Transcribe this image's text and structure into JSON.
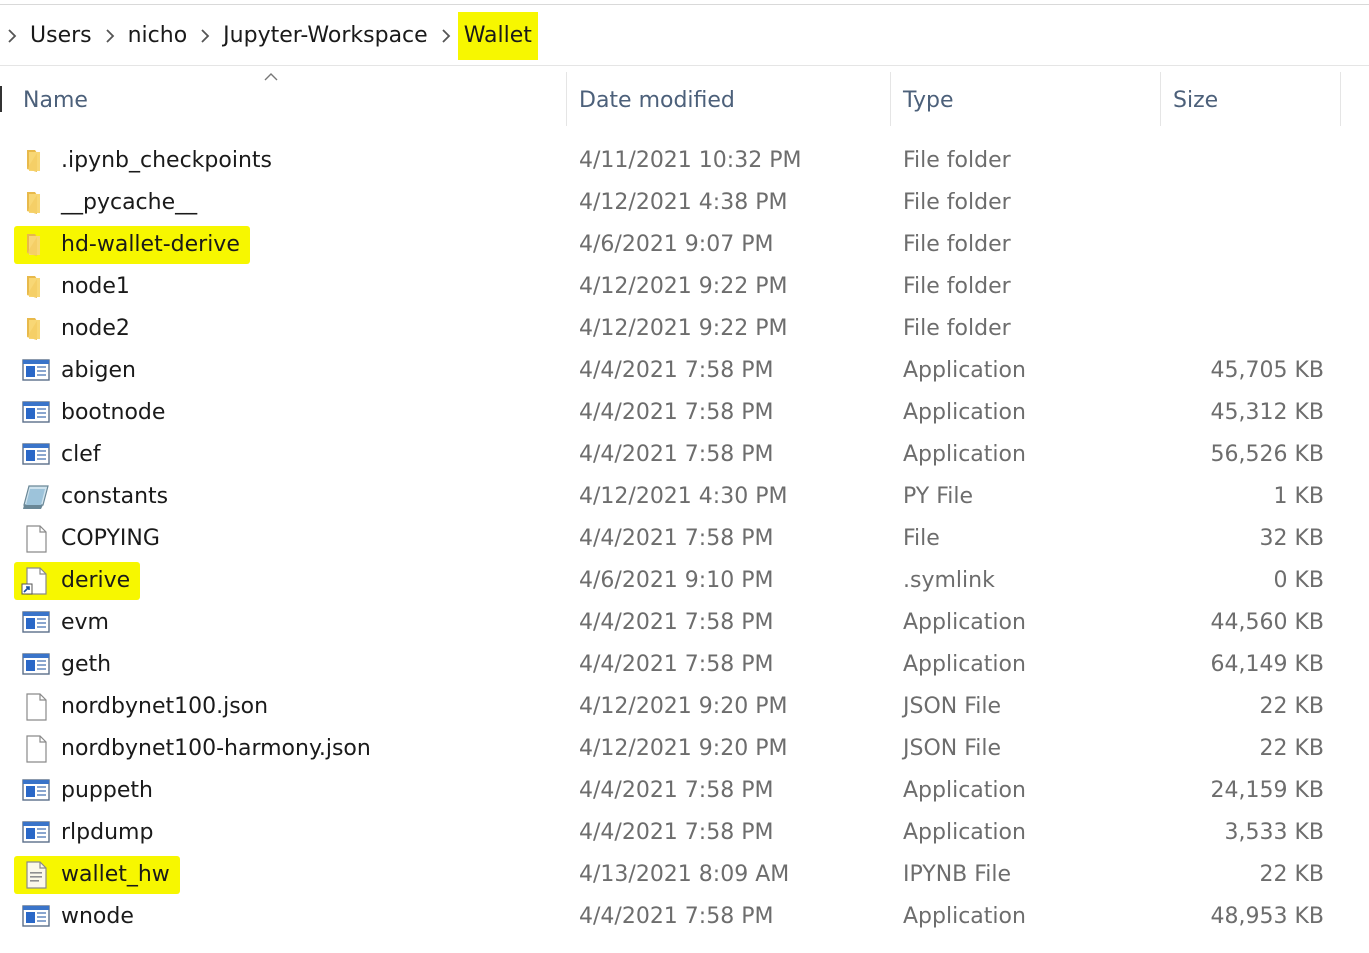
{
  "breadcrumb": {
    "items": [
      "Users",
      "nicho",
      "Jupyter-Workspace",
      "Wallet"
    ]
  },
  "columns": {
    "name": "Name",
    "date": "Date modified",
    "type": "Type",
    "size": "Size"
  },
  "highlight_color": "#f7f700",
  "files": [
    {
      "name": ".ipynb_checkpoints",
      "date": "4/11/2021 10:32 PM",
      "type": "File folder",
      "size": "",
      "icon": "folder-icon",
      "highlighted": false
    },
    {
      "name": "__pycache__",
      "date": "4/12/2021 4:38 PM",
      "type": "File folder",
      "size": "",
      "icon": "folder-icon",
      "highlighted": false
    },
    {
      "name": "hd-wallet-derive",
      "date": "4/6/2021 9:07 PM",
      "type": "File folder",
      "size": "",
      "icon": "folder-icon",
      "highlighted": true
    },
    {
      "name": "node1",
      "date": "4/12/2021 9:22 PM",
      "type": "File folder",
      "size": "",
      "icon": "folder-icon",
      "highlighted": false
    },
    {
      "name": "node2",
      "date": "4/12/2021 9:22 PM",
      "type": "File folder",
      "size": "",
      "icon": "folder-icon",
      "highlighted": false
    },
    {
      "name": "abigen",
      "date": "4/4/2021 7:58 PM",
      "type": "Application",
      "size": "45,705 KB",
      "icon": "application-icon",
      "highlighted": false
    },
    {
      "name": "bootnode",
      "date": "4/4/2021 7:58 PM",
      "type": "Application",
      "size": "45,312 KB",
      "icon": "application-icon",
      "highlighted": false
    },
    {
      "name": "clef",
      "date": "4/4/2021 7:58 PM",
      "type": "Application",
      "size": "56,526 KB",
      "icon": "application-icon",
      "highlighted": false
    },
    {
      "name": "constants",
      "date": "4/12/2021 4:30 PM",
      "type": "PY File",
      "size": "1 KB",
      "icon": "python-file-icon",
      "highlighted": false
    },
    {
      "name": "COPYING",
      "date": "4/4/2021 7:58 PM",
      "type": "File",
      "size": "32 KB",
      "icon": "blank-file-icon",
      "highlighted": false
    },
    {
      "name": "derive",
      "date": "4/6/2021 9:10 PM",
      "type": ".symlink",
      "size": "0 KB",
      "icon": "symlink-file-icon",
      "highlighted": true
    },
    {
      "name": "evm",
      "date": "4/4/2021 7:58 PM",
      "type": "Application",
      "size": "44,560 KB",
      "icon": "application-icon",
      "highlighted": false
    },
    {
      "name": "geth",
      "date": "4/4/2021 7:58 PM",
      "type": "Application",
      "size": "64,149 KB",
      "icon": "application-icon",
      "highlighted": false
    },
    {
      "name": "nordbynet100.json",
      "date": "4/12/2021 9:20 PM",
      "type": "JSON File",
      "size": "22 KB",
      "icon": "blank-file-icon",
      "highlighted": false
    },
    {
      "name": "nordbynet100-harmony.json",
      "date": "4/12/2021 9:20 PM",
      "type": "JSON File",
      "size": "22 KB",
      "icon": "blank-file-icon",
      "highlighted": false
    },
    {
      "name": "puppeth",
      "date": "4/4/2021 7:58 PM",
      "type": "Application",
      "size": "24,159 KB",
      "icon": "application-icon",
      "highlighted": false
    },
    {
      "name": "rlpdump",
      "date": "4/4/2021 7:58 PM",
      "type": "Application",
      "size": "3,533 KB",
      "icon": "application-icon",
      "highlighted": false
    },
    {
      "name": "wallet_hw",
      "date": "4/13/2021 8:09 AM",
      "type": "IPYNB File",
      "size": "22 KB",
      "icon": "notebook-file-icon",
      "highlighted": true
    },
    {
      "name": "wnode",
      "date": "4/4/2021 7:58 PM",
      "type": "Application",
      "size": "48,953 KB",
      "icon": "application-icon",
      "highlighted": false
    }
  ]
}
